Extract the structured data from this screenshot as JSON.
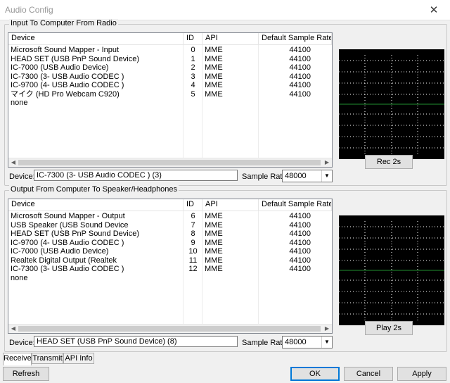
{
  "window": {
    "title": "Audio Config",
    "close_glyph": "✕"
  },
  "input_group": {
    "label": "Input To Computer From Radio",
    "columns": [
      "Device",
      "ID",
      "API",
      "Default Sample Rate"
    ],
    "rows": [
      [
        "Microsoft Sound Mapper - Input",
        "0",
        "MME",
        "44100"
      ],
      [
        "HEAD SET (USB PnP Sound Device)",
        "1",
        "MME",
        "44100"
      ],
      [
        "IC-7000 (USB Audio Device)",
        "2",
        "MME",
        "44100"
      ],
      [
        "IC-7300 (3- USB Audio CODEC )",
        "3",
        "MME",
        "44100"
      ],
      [
        "IC-9700 (4- USB Audio CODEC )",
        "4",
        "MME",
        "44100"
      ],
      [
        "マイク (HD Pro Webcam C920)",
        "5",
        "MME",
        "44100"
      ],
      [
        "none",
        "",
        "",
        ""
      ]
    ],
    "device_label": "Device:",
    "device_value": "IC-7300 (3- USB Audio CODEC ) (3)",
    "rate_label": "Sample Rate:",
    "rate_value": "48000",
    "test_button": "Rec 2s"
  },
  "output_group": {
    "label": "Output From Computer To Speaker/Headphones",
    "columns": [
      "Device",
      "ID",
      "API",
      "Default Sample Rate"
    ],
    "rows": [
      [
        "Microsoft Sound Mapper - Output",
        "6",
        "MME",
        "44100"
      ],
      [
        "USB Speaker (USB Sound Device",
        "7",
        "MME",
        "44100"
      ],
      [
        "HEAD SET (USB PnP Sound Device)",
        "8",
        "MME",
        "44100"
      ],
      [
        "IC-9700 (4- USB Audio CODEC )",
        "9",
        "MME",
        "44100"
      ],
      [
        "IC-7000 (USB Audio Device)",
        "10",
        "MME",
        "44100"
      ],
      [
        "Realtek Digital Output (Realtek",
        "11",
        "MME",
        "44100"
      ],
      [
        "IC-7300 (3- USB Audio CODEC )",
        "12",
        "MME",
        "44100"
      ],
      [
        "none",
        "",
        "",
        ""
      ]
    ],
    "device_label": "Device:",
    "device_value": "HEAD SET (USB PnP Sound Device) (8)",
    "rate_label": "Sample Rate:",
    "rate_value": "48000",
    "test_button": "Play 2s"
  },
  "tabs": [
    {
      "label": "Receive",
      "active": true
    },
    {
      "label": "Transmit",
      "active": false
    },
    {
      "label": "API Info",
      "active": false
    }
  ],
  "buttons": {
    "refresh": "Refresh",
    "ok": "OK",
    "cancel": "Cancel",
    "apply": "Apply"
  },
  "icons": {
    "scroll_left": "◀",
    "scroll_right": "▶",
    "dropdown": "▼"
  },
  "colors": {
    "scope_bg": "#000000",
    "scope_grid": "#ffffff",
    "scope_trace": "#1f8f2f",
    "default_button_border": "#0078d7"
  }
}
